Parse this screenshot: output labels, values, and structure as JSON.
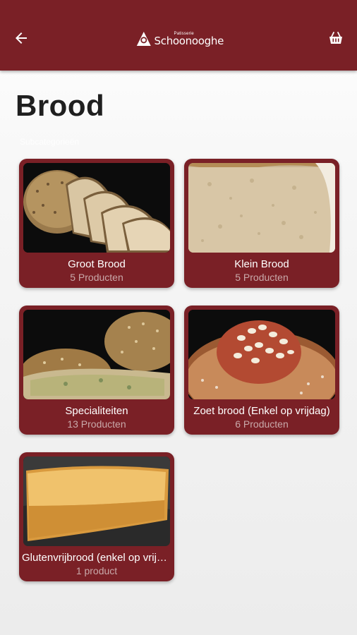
{
  "header": {
    "logo_small": "Patisserie",
    "logo_name": "Schoonooghe",
    "back_icon": "arrow-left-icon",
    "cart_icon": "basket-icon",
    "color": "#7a2026"
  },
  "page": {
    "title": "Brood",
    "subtitle": "Subcategorieën"
  },
  "categories": [
    {
      "title": "Groot Brood",
      "count": "5 Producten",
      "image": "sliced-seeded-loaf"
    },
    {
      "title": "Klein Brood",
      "count": "5 Producten",
      "image": "white-bread-crumb"
    },
    {
      "title": "Specialiteiten",
      "count": "13 Producten",
      "image": "specialty-loaves"
    },
    {
      "title": "Zoet brood (Enkel op vrijdag)",
      "count": "6 Producten",
      "image": "sweet-bread-with-almonds"
    },
    {
      "title": "Glutenvrijbrood (enkel op vrijdag)",
      "count": "1 product",
      "image": "gluten-free-loaf"
    }
  ]
}
